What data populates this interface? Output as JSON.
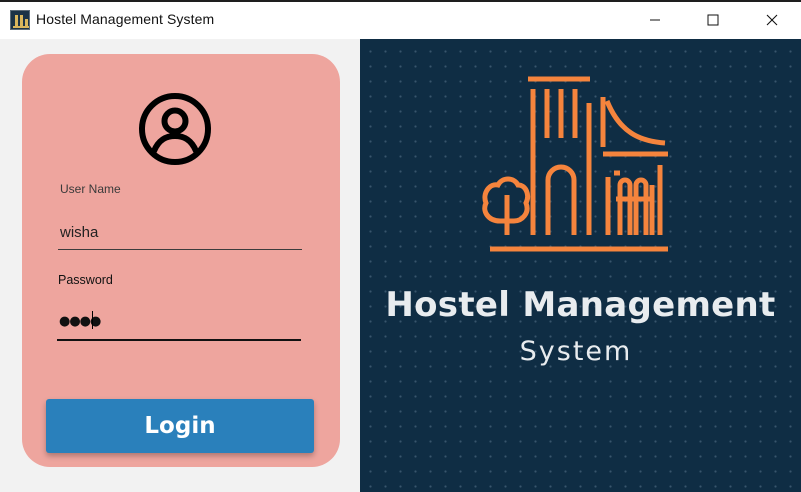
{
  "window": {
    "title": "Hostel Management System",
    "icons": [
      "app-logo-icon",
      "minimize-icon",
      "maximize-icon",
      "close-icon"
    ]
  },
  "login": {
    "avatar_icon": "user-circle-icon",
    "username_label": "User Name",
    "username_value": "wisha",
    "password_label": "Password",
    "password_masked": "●●●●",
    "login_button": "Login"
  },
  "branding": {
    "title": "Hostel Management",
    "subtitle": "System",
    "logo_icon": "hostel-building-logo-icon"
  },
  "colors": {
    "card_background": "#eea59e",
    "login_button": "#2a80bb",
    "brand_panel": "#0f2d44",
    "logo_accent": "#f5843d",
    "brand_text": "#e8ecef"
  }
}
